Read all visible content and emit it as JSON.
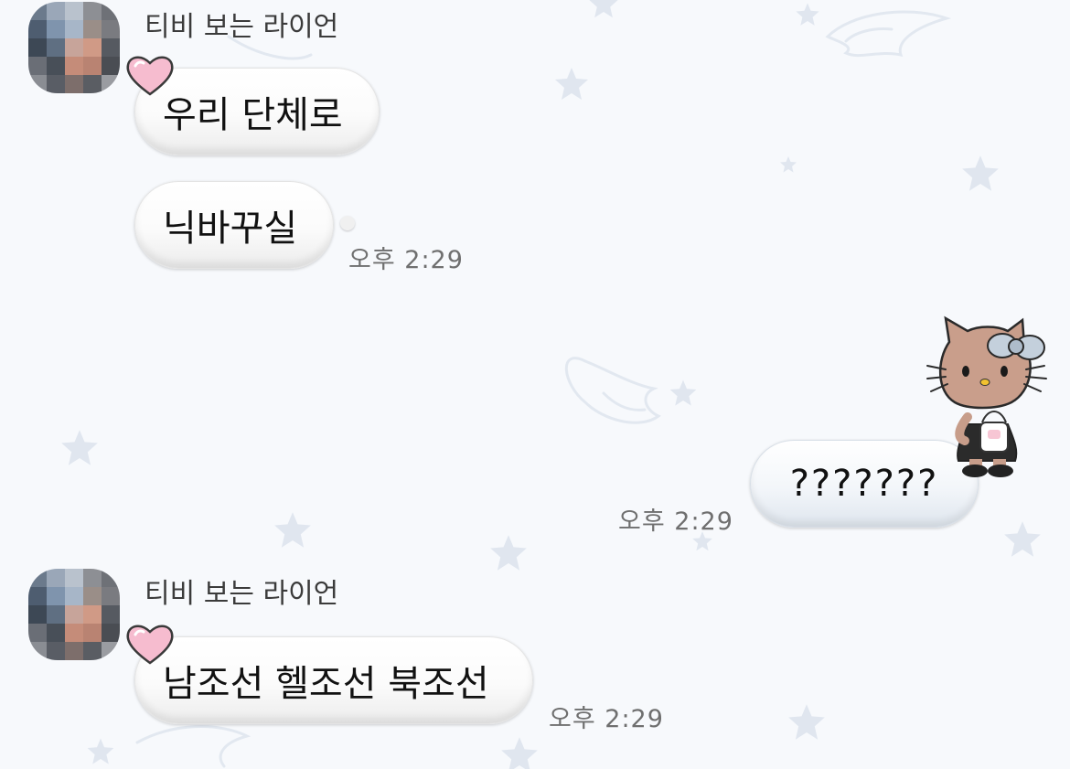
{
  "chat": {
    "messages": [
      {
        "sender": "티비 보는 라이언",
        "text": "우리 단체로"
      },
      {
        "text": "닉바꾸실",
        "time": "오후 2:29"
      },
      {
        "text": "???????",
        "time": "오후 2:29",
        "mine": true
      },
      {
        "sender": "티비 보는 라이언",
        "text": "남조선 헬조선 북조선",
        "time": "오후 2:29"
      }
    ]
  },
  "icons": {
    "avatar": "pixelated-avatar",
    "heart": "pink-heart-icon",
    "sticker": "hello-kitty-sticker",
    "background": "stars-and-angel-wings"
  },
  "colors": {
    "background": "#f7f9fc",
    "heart": "#f6bccf",
    "sender_text": "#3b3b3b",
    "time_text": "#6f6f6f"
  }
}
